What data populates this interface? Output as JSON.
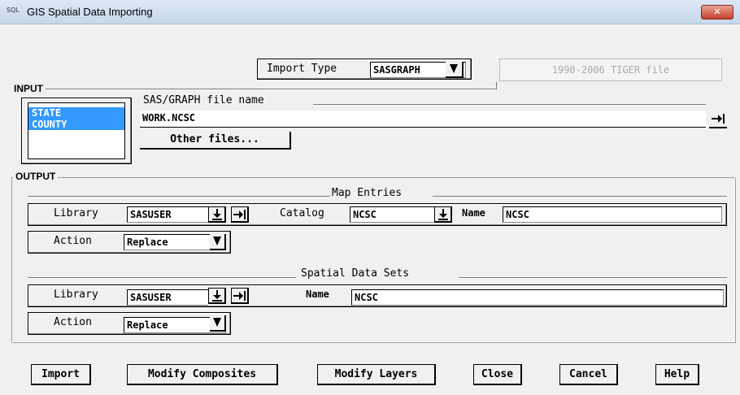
{
  "window": {
    "title": "GIS Spatial Data Importing",
    "app_badge": "SQL",
    "close_icon": "close-icon"
  },
  "import_type": {
    "label": "Import Type",
    "value": "SASGRAPH",
    "tiger_button": "1990-2006 TIGER file"
  },
  "input": {
    "legend": "INPUT",
    "list_items": [
      "STATE",
      "COUNTY"
    ],
    "file_label": "SAS/GRAPH file name",
    "file_value": "WORK.NCSC",
    "other_files": "Other files..."
  },
  "output": {
    "legend": "OUTPUT",
    "map_entries": {
      "heading": "Map Entries",
      "library_label": "Library",
      "library_value": "SASUSER",
      "catalog_label": "Catalog",
      "catalog_value": "NCSC",
      "name_label": "Name",
      "name_value": "NCSC",
      "action_label": "Action",
      "action_value": "Replace"
    },
    "spatial": {
      "heading": "Spatial Data Sets",
      "library_label": "Library",
      "library_value": "SASUSER",
      "name_label": "Name",
      "name_value": "NCSC",
      "action_label": "Action",
      "action_value": "Replace"
    }
  },
  "buttons": {
    "import": "Import",
    "modify_composites": "Modify Composites",
    "modify_layers": "Modify Layers",
    "close": "Close",
    "cancel": "Cancel",
    "help": "Help"
  }
}
